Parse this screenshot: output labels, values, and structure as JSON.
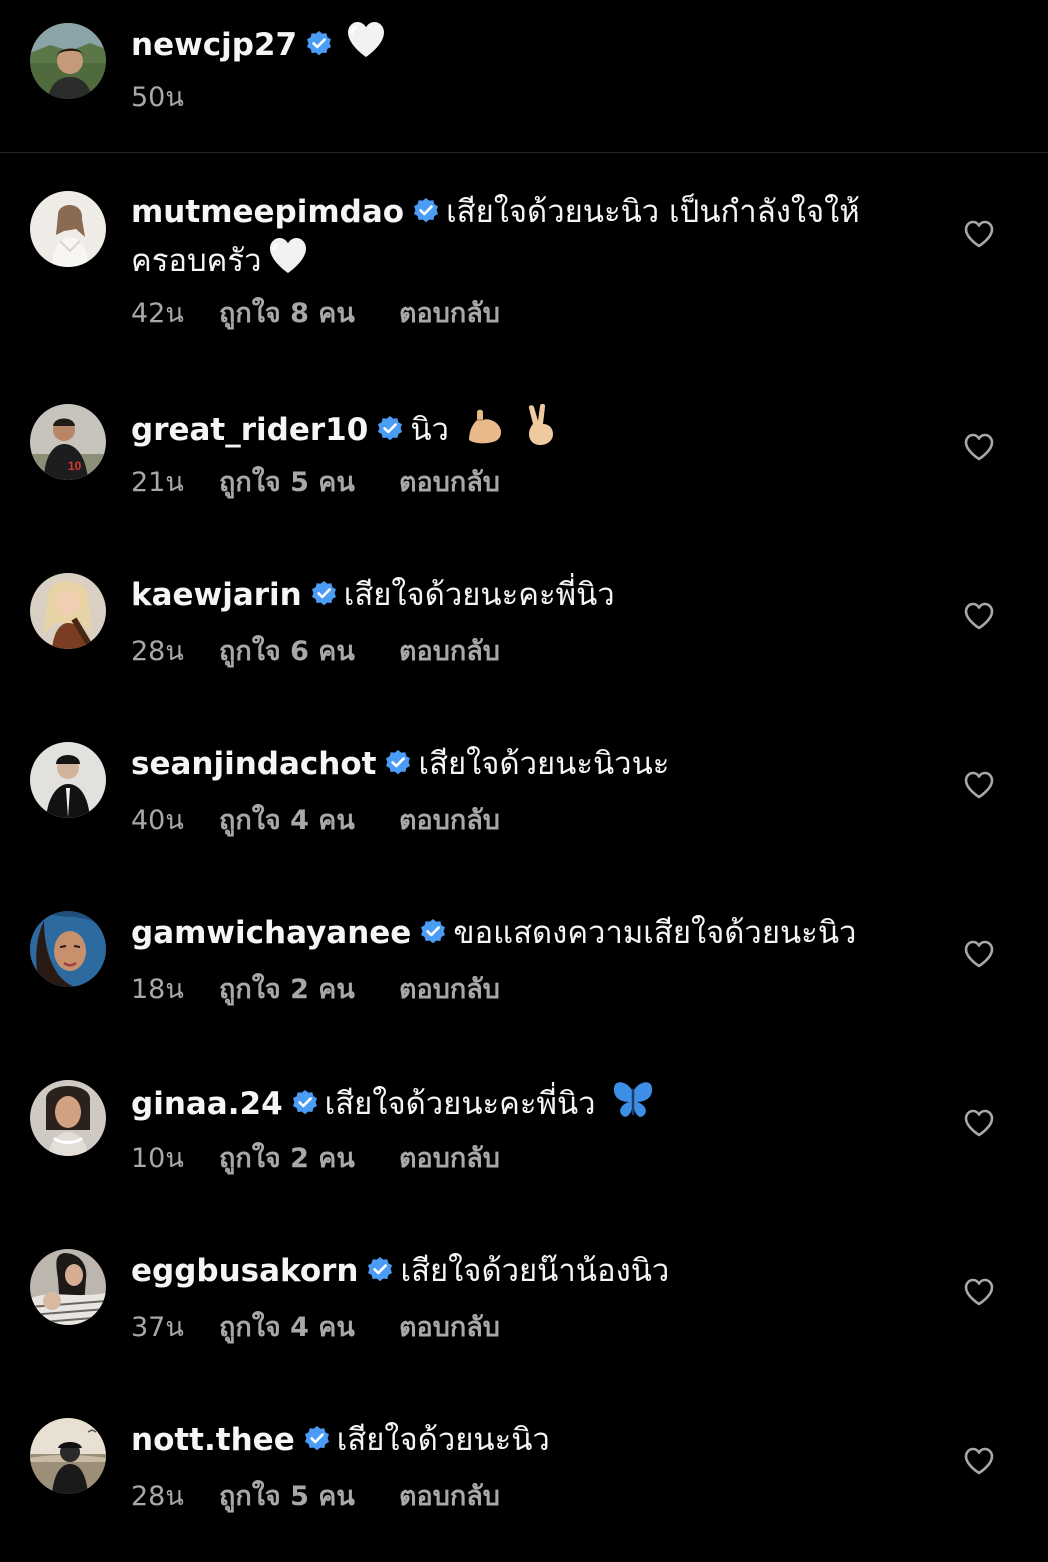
{
  "caption": {
    "username": "newcjp27",
    "text": "",
    "emoji": "white-heart",
    "time": "50น"
  },
  "comments": [
    {
      "username": "mutmeepimdao",
      "text_line1": "เสียใจด้วยนะนิว เป็นกำลังใจให้",
      "text_line2": "ครอบครัว",
      "emoji": "white-heart",
      "time": "42น",
      "likes": "ถูกใจ 8 คน",
      "reply": "ตอบกลับ"
    },
    {
      "username": "great_rider10",
      "text": "นิว",
      "emoji": "flexed-biceps-and-victory-hand",
      "time": "21น",
      "likes": "ถูกใจ 5 คน",
      "reply": "ตอบกลับ"
    },
    {
      "username": "kaewjarin",
      "text": "เสียใจด้วยนะคะพี่นิว",
      "time": "28น",
      "likes": "ถูกใจ 6 คน",
      "reply": "ตอบกลับ"
    },
    {
      "username": "seanjindachot",
      "text": "เสียใจด้วยนะนิวนะ",
      "time": "40น",
      "likes": "ถูกใจ 4 คน",
      "reply": "ตอบกลับ"
    },
    {
      "username": "gamwichayanee",
      "text": "ขอแสดงความเสียใจด้วยนะนิว",
      "time": "18น",
      "likes": "ถูกใจ 2 คน",
      "reply": "ตอบกลับ"
    },
    {
      "username": "ginaa.24",
      "text": "เสียใจด้วยนะคะพี่นิว",
      "emoji": "butterfly",
      "time": "10น",
      "likes": "ถูกใจ 2 คน",
      "reply": "ตอบกลับ"
    },
    {
      "username": "eggbusakorn",
      "text": "เสียใจด้วยน๊าน้องนิว",
      "time": "37น",
      "likes": "ถูกใจ 4 คน",
      "reply": "ตอบกลับ"
    },
    {
      "username": "nott.thee",
      "text": "เสียใจด้วยนะนิว",
      "time": "28น",
      "likes": "ถูกใจ 5 คน",
      "reply": "ตอบกลับ"
    }
  ],
  "colors": {
    "background": "#000000",
    "primary_text": "#f5f5f5",
    "secondary_text": "#a8a8a8",
    "verified_badge": "#4a9cf5",
    "divider": "#262626"
  }
}
